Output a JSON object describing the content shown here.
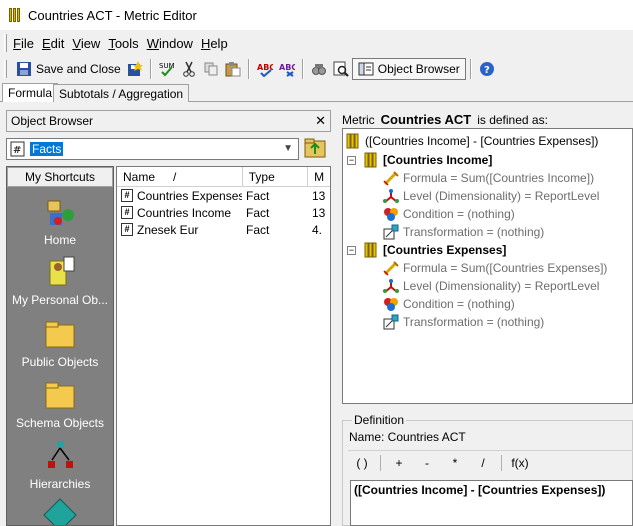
{
  "window": {
    "title": "Countries ACT - Metric Editor"
  },
  "menu": [
    {
      "prefix": "",
      "key": "F",
      "rest": "ile"
    },
    {
      "prefix": "",
      "key": "E",
      "rest": "dit"
    },
    {
      "prefix": "",
      "key": "V",
      "rest": "iew"
    },
    {
      "prefix": "",
      "key": "T",
      "rest": "ools"
    },
    {
      "prefix": "",
      "key": "W",
      "rest": "indow"
    },
    {
      "prefix": "",
      "key": "H",
      "rest": "elp"
    }
  ],
  "toolbar": {
    "save_close": "Save and Close",
    "object_browser": "Object Browser"
  },
  "tabs": {
    "formula": "Formula",
    "subtotals": "Subtotals / Aggregation"
  },
  "object_browser": {
    "title": "Object Browser",
    "combo_value": "Facts",
    "shortcuts_header": "My Shortcuts",
    "shortcuts": [
      "Home",
      "My Personal Ob...",
      "Public Objects",
      "Schema Objects",
      "Hierarchies"
    ],
    "columns": [
      "Name",
      "Type",
      "M"
    ],
    "sort_indicator": "/",
    "rows": [
      {
        "name": "Countries Expenses",
        "type": "Fact",
        "m": "13"
      },
      {
        "name": "Countries Income",
        "type": "Fact",
        "m": "13"
      },
      {
        "name": "Znesek Eur",
        "type": "Fact",
        "m": "4."
      }
    ]
  },
  "metric": {
    "prefix": "Metric",
    "name": "Countries ACT",
    "suffix": "is defined as:",
    "root": "([Countries Income] - [Countries Expenses])",
    "groups": [
      {
        "name": "[Countries Income]",
        "formula": "Formula = Sum([Countries Income])",
        "level": "Level (Dimensionality) = ReportLevel",
        "condition": "Condition = (nothing)",
        "transformation": "Transformation = (nothing)"
      },
      {
        "name": "[Countries Expenses]",
        "formula": "Formula = Sum([Countries Expenses])",
        "level": "Level (Dimensionality) = ReportLevel",
        "condition": "Condition = (nothing)",
        "transformation": "Transformation = (nothing)"
      }
    ]
  },
  "definition": {
    "legend": "Definition",
    "name_line": "Name:  Countries ACT",
    "operators": [
      "( )",
      "+",
      "-",
      "*",
      "/",
      "f(x)"
    ],
    "formula": "([Countries Income] - [Countries Expenses])"
  },
  "colors": {
    "selection": "#0078d7",
    "shortcut_bg": "#808080",
    "tree_gray": "#6d6d6d"
  }
}
